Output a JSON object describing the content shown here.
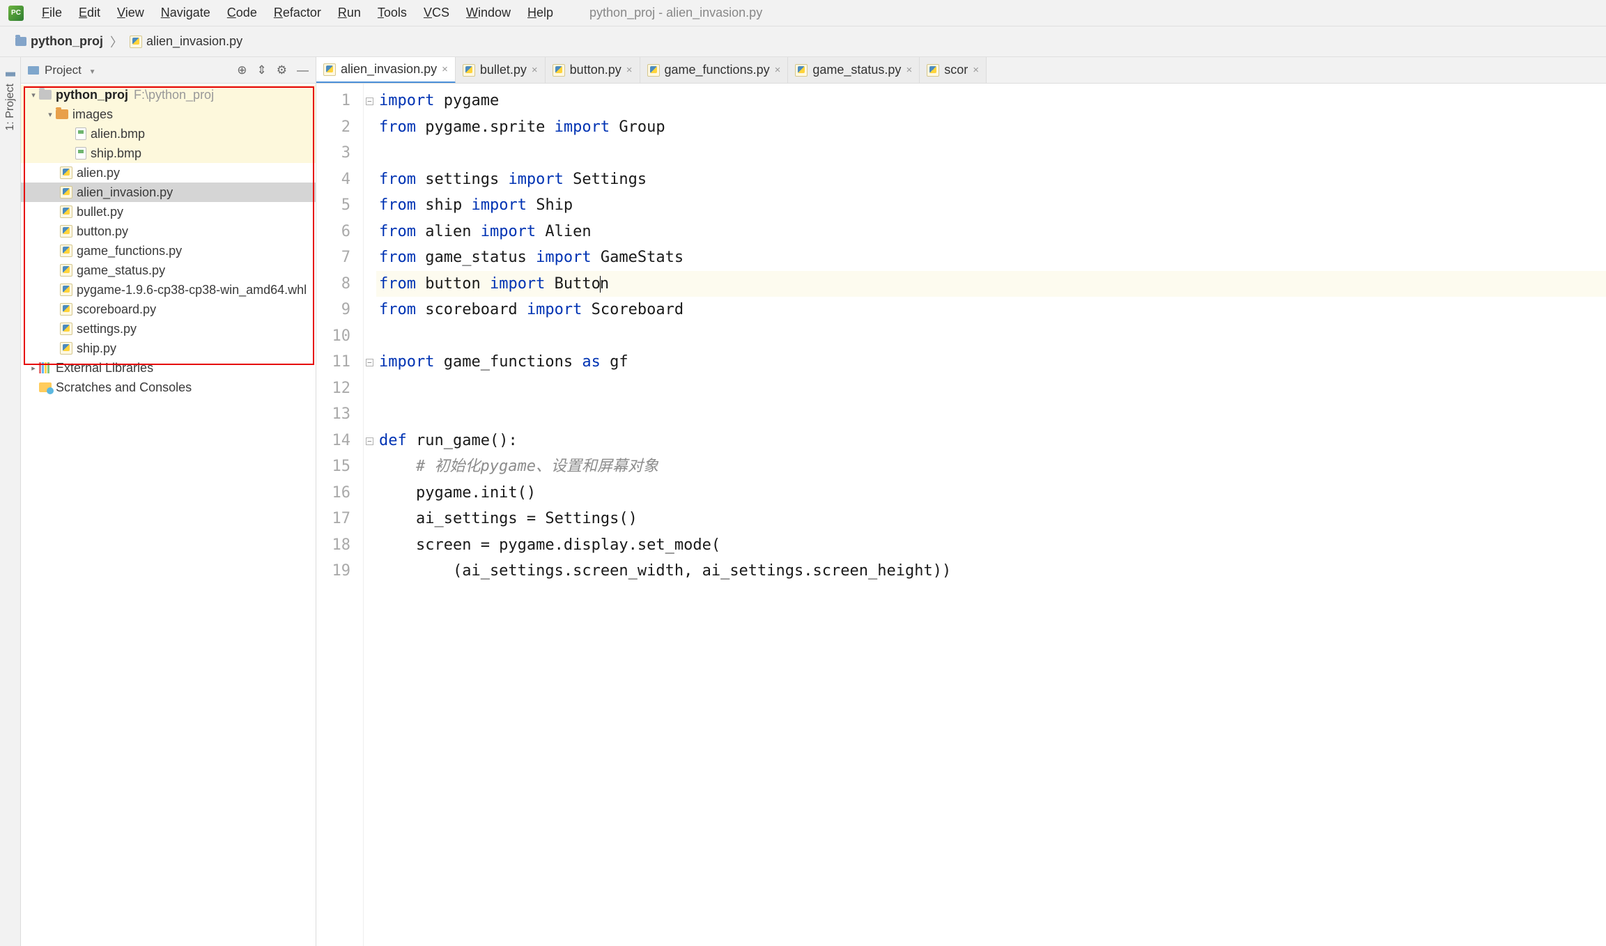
{
  "window_title": "python_proj - alien_invasion.py",
  "menu": [
    "File",
    "Edit",
    "View",
    "Navigate",
    "Code",
    "Refactor",
    "Run",
    "Tools",
    "VCS",
    "Window",
    "Help"
  ],
  "breadcrumb": {
    "project": "python_proj",
    "file": "alien_invasion.py"
  },
  "project_panel": {
    "title": "Project",
    "root": {
      "name": "python_proj",
      "path": "F:\\python_proj"
    },
    "images_folder": "images",
    "images_files": [
      "alien.bmp",
      "ship.bmp"
    ],
    "py_files": [
      "alien.py",
      "alien_invasion.py",
      "bullet.py",
      "button.py",
      "game_functions.py",
      "game_status.py",
      "pygame-1.9.6-cp38-cp38-win_amd64.whl",
      "scoreboard.py",
      "settings.py",
      "ship.py"
    ],
    "selected": "alien_invasion.py",
    "external": "External Libraries",
    "scratches": "Scratches and Consoles"
  },
  "tabs": [
    "alien_invasion.py",
    "bullet.py",
    "button.py",
    "game_functions.py",
    "game_status.py",
    "scor"
  ],
  "active_tab": 0,
  "code_lines": [
    {
      "n": 1,
      "fold": true,
      "segs": [
        [
          "kw",
          "import"
        ],
        [
          "",
          " pygame"
        ]
      ]
    },
    {
      "n": 2,
      "segs": [
        [
          "kw",
          "from"
        ],
        [
          "",
          " pygame.sprite "
        ],
        [
          "kw",
          "import"
        ],
        [
          "",
          " Group"
        ]
      ]
    },
    {
      "n": 3,
      "segs": [
        [
          "",
          ""
        ]
      ]
    },
    {
      "n": 4,
      "segs": [
        [
          "kw",
          "from"
        ],
        [
          "",
          " settings "
        ],
        [
          "kw",
          "import"
        ],
        [
          "",
          " Settings"
        ]
      ]
    },
    {
      "n": 5,
      "segs": [
        [
          "kw",
          "from"
        ],
        [
          "",
          " ship "
        ],
        [
          "kw",
          "import"
        ],
        [
          "",
          " Ship"
        ]
      ]
    },
    {
      "n": 6,
      "segs": [
        [
          "kw",
          "from"
        ],
        [
          "",
          " alien "
        ],
        [
          "kw",
          "import"
        ],
        [
          "",
          " Alien"
        ]
      ]
    },
    {
      "n": 7,
      "segs": [
        [
          "kw",
          "from"
        ],
        [
          "",
          " game_status "
        ],
        [
          "kw",
          "import"
        ],
        [
          "",
          " GameStats"
        ]
      ]
    },
    {
      "n": 8,
      "hl": true,
      "segs": [
        [
          "kw",
          "from"
        ],
        [
          "",
          " button "
        ],
        [
          "kw",
          "import"
        ],
        [
          "",
          " Butto"
        ],
        [
          "cursor",
          ""
        ],
        [
          "",
          "n"
        ]
      ]
    },
    {
      "n": 9,
      "segs": [
        [
          "kw",
          "from"
        ],
        [
          "",
          " scoreboard "
        ],
        [
          "kw",
          "import"
        ],
        [
          "",
          " Scoreboard"
        ]
      ]
    },
    {
      "n": 10,
      "segs": [
        [
          "",
          ""
        ]
      ]
    },
    {
      "n": 11,
      "fold": true,
      "segs": [
        [
          "kw",
          "import"
        ],
        [
          "",
          " game_functions "
        ],
        [
          "kw",
          "as"
        ],
        [
          "",
          " gf"
        ]
      ]
    },
    {
      "n": 12,
      "segs": [
        [
          "",
          ""
        ]
      ]
    },
    {
      "n": 13,
      "segs": [
        [
          "",
          ""
        ]
      ]
    },
    {
      "n": 14,
      "fold": true,
      "segs": [
        [
          "kw",
          "def"
        ],
        [
          "",
          " run_game():"
        ]
      ]
    },
    {
      "n": 15,
      "segs": [
        [
          "comment",
          "    # 初始化pygame、设置和屏幕对象"
        ]
      ]
    },
    {
      "n": 16,
      "segs": [
        [
          "",
          "    pygame.init()"
        ]
      ]
    },
    {
      "n": 17,
      "segs": [
        [
          "",
          "    ai_settings = Settings()"
        ]
      ]
    },
    {
      "n": 18,
      "segs": [
        [
          "",
          "    screen = pygame.display.set_mode("
        ]
      ]
    },
    {
      "n": 19,
      "segs": [
        [
          "",
          "        (ai_settings.screen_width, ai_settings.screen_height))"
        ]
      ]
    }
  ],
  "side_tab": "1: Project"
}
